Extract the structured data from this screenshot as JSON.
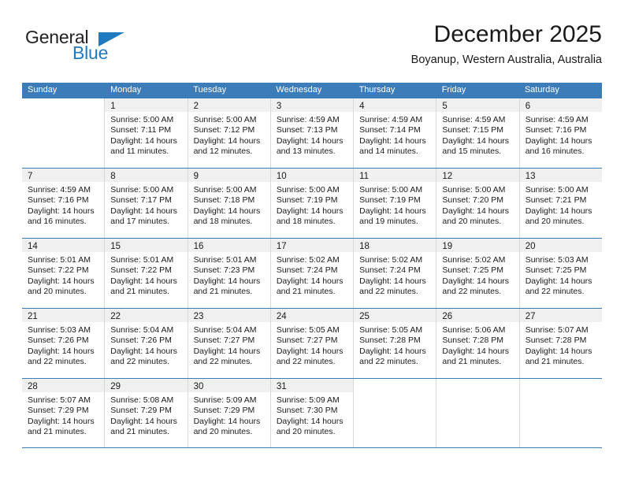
{
  "logo": {
    "word_top": "General",
    "word_bottom": "Blue",
    "triangle_color": "#1f7ac0",
    "text_color": "#231f20"
  },
  "header": {
    "title": "December 2025",
    "subtitle": "Boyanup, Western Australia, Australia"
  },
  "colors": {
    "header_row_bg": "#3b7cb9",
    "header_row_text": "#ffffff",
    "daynum_band_bg": "#f0f0f0",
    "cell_border": "#d8d8d8",
    "week_border": "#3b7cb9"
  },
  "weekday_headers": [
    "Sunday",
    "Monday",
    "Tuesday",
    "Wednesday",
    "Thursday",
    "Friday",
    "Saturday"
  ],
  "weeks": [
    [
      {
        "day": "",
        "lines": []
      },
      {
        "day": "1",
        "lines": [
          "Sunrise: 5:00 AM",
          "Sunset: 7:11 PM",
          "Daylight: 14 hours",
          "and 11 minutes."
        ]
      },
      {
        "day": "2",
        "lines": [
          "Sunrise: 5:00 AM",
          "Sunset: 7:12 PM",
          "Daylight: 14 hours",
          "and 12 minutes."
        ]
      },
      {
        "day": "3",
        "lines": [
          "Sunrise: 4:59 AM",
          "Sunset: 7:13 PM",
          "Daylight: 14 hours",
          "and 13 minutes."
        ]
      },
      {
        "day": "4",
        "lines": [
          "Sunrise: 4:59 AM",
          "Sunset: 7:14 PM",
          "Daylight: 14 hours",
          "and 14 minutes."
        ]
      },
      {
        "day": "5",
        "lines": [
          "Sunrise: 4:59 AM",
          "Sunset: 7:15 PM",
          "Daylight: 14 hours",
          "and 15 minutes."
        ]
      },
      {
        "day": "6",
        "lines": [
          "Sunrise: 4:59 AM",
          "Sunset: 7:16 PM",
          "Daylight: 14 hours",
          "and 16 minutes."
        ]
      }
    ],
    [
      {
        "day": "7",
        "lines": [
          "Sunrise: 4:59 AM",
          "Sunset: 7:16 PM",
          "Daylight: 14 hours",
          "and 16 minutes."
        ]
      },
      {
        "day": "8",
        "lines": [
          "Sunrise: 5:00 AM",
          "Sunset: 7:17 PM",
          "Daylight: 14 hours",
          "and 17 minutes."
        ]
      },
      {
        "day": "9",
        "lines": [
          "Sunrise: 5:00 AM",
          "Sunset: 7:18 PM",
          "Daylight: 14 hours",
          "and 18 minutes."
        ]
      },
      {
        "day": "10",
        "lines": [
          "Sunrise: 5:00 AM",
          "Sunset: 7:19 PM",
          "Daylight: 14 hours",
          "and 18 minutes."
        ]
      },
      {
        "day": "11",
        "lines": [
          "Sunrise: 5:00 AM",
          "Sunset: 7:19 PM",
          "Daylight: 14 hours",
          "and 19 minutes."
        ]
      },
      {
        "day": "12",
        "lines": [
          "Sunrise: 5:00 AM",
          "Sunset: 7:20 PM",
          "Daylight: 14 hours",
          "and 20 minutes."
        ]
      },
      {
        "day": "13",
        "lines": [
          "Sunrise: 5:00 AM",
          "Sunset: 7:21 PM",
          "Daylight: 14 hours",
          "and 20 minutes."
        ]
      }
    ],
    [
      {
        "day": "14",
        "lines": [
          "Sunrise: 5:01 AM",
          "Sunset: 7:22 PM",
          "Daylight: 14 hours",
          "and 20 minutes."
        ]
      },
      {
        "day": "15",
        "lines": [
          "Sunrise: 5:01 AM",
          "Sunset: 7:22 PM",
          "Daylight: 14 hours",
          "and 21 minutes."
        ]
      },
      {
        "day": "16",
        "lines": [
          "Sunrise: 5:01 AM",
          "Sunset: 7:23 PM",
          "Daylight: 14 hours",
          "and 21 minutes."
        ]
      },
      {
        "day": "17",
        "lines": [
          "Sunrise: 5:02 AM",
          "Sunset: 7:24 PM",
          "Daylight: 14 hours",
          "and 21 minutes."
        ]
      },
      {
        "day": "18",
        "lines": [
          "Sunrise: 5:02 AM",
          "Sunset: 7:24 PM",
          "Daylight: 14 hours",
          "and 22 minutes."
        ]
      },
      {
        "day": "19",
        "lines": [
          "Sunrise: 5:02 AM",
          "Sunset: 7:25 PM",
          "Daylight: 14 hours",
          "and 22 minutes."
        ]
      },
      {
        "day": "20",
        "lines": [
          "Sunrise: 5:03 AM",
          "Sunset: 7:25 PM",
          "Daylight: 14 hours",
          "and 22 minutes."
        ]
      }
    ],
    [
      {
        "day": "21",
        "lines": [
          "Sunrise: 5:03 AM",
          "Sunset: 7:26 PM",
          "Daylight: 14 hours",
          "and 22 minutes."
        ]
      },
      {
        "day": "22",
        "lines": [
          "Sunrise: 5:04 AM",
          "Sunset: 7:26 PM",
          "Daylight: 14 hours",
          "and 22 minutes."
        ]
      },
      {
        "day": "23",
        "lines": [
          "Sunrise: 5:04 AM",
          "Sunset: 7:27 PM",
          "Daylight: 14 hours",
          "and 22 minutes."
        ]
      },
      {
        "day": "24",
        "lines": [
          "Sunrise: 5:05 AM",
          "Sunset: 7:27 PM",
          "Daylight: 14 hours",
          "and 22 minutes."
        ]
      },
      {
        "day": "25",
        "lines": [
          "Sunrise: 5:05 AM",
          "Sunset: 7:28 PM",
          "Daylight: 14 hours",
          "and 22 minutes."
        ]
      },
      {
        "day": "26",
        "lines": [
          "Sunrise: 5:06 AM",
          "Sunset: 7:28 PM",
          "Daylight: 14 hours",
          "and 21 minutes."
        ]
      },
      {
        "day": "27",
        "lines": [
          "Sunrise: 5:07 AM",
          "Sunset: 7:28 PM",
          "Daylight: 14 hours",
          "and 21 minutes."
        ]
      }
    ],
    [
      {
        "day": "28",
        "lines": [
          "Sunrise: 5:07 AM",
          "Sunset: 7:29 PM",
          "Daylight: 14 hours",
          "and 21 minutes."
        ]
      },
      {
        "day": "29",
        "lines": [
          "Sunrise: 5:08 AM",
          "Sunset: 7:29 PM",
          "Daylight: 14 hours",
          "and 21 minutes."
        ]
      },
      {
        "day": "30",
        "lines": [
          "Sunrise: 5:09 AM",
          "Sunset: 7:29 PM",
          "Daylight: 14 hours",
          "and 20 minutes."
        ]
      },
      {
        "day": "31",
        "lines": [
          "Sunrise: 5:09 AM",
          "Sunset: 7:30 PM",
          "Daylight: 14 hours",
          "and 20 minutes."
        ]
      },
      {
        "day": "",
        "lines": []
      },
      {
        "day": "",
        "lines": []
      },
      {
        "day": "",
        "lines": []
      }
    ]
  ]
}
